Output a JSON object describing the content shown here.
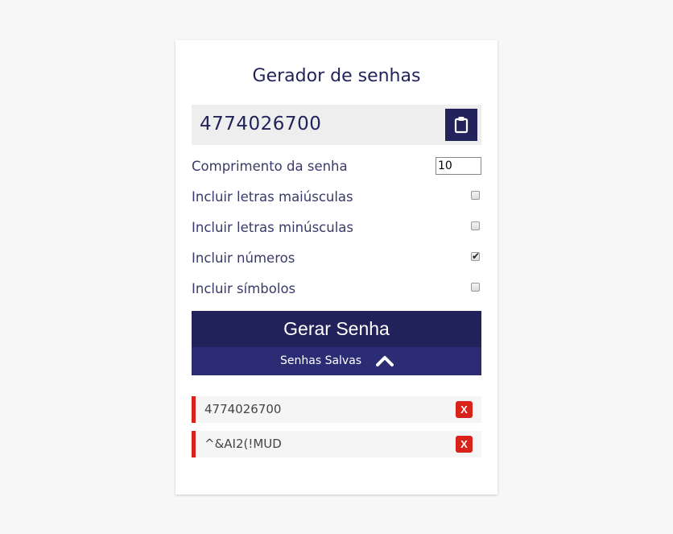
{
  "app": {
    "title": "Gerador de senhas"
  },
  "result": {
    "password": "4774026700",
    "copy_icon": "clipboard-icon"
  },
  "options": {
    "length_label": "Comprimento da senha",
    "length_value": "10",
    "uppercase_label": "Incluir letras maiúsculas",
    "uppercase_checked": false,
    "lowercase_label": "Incluir letras minúsculas",
    "lowercase_checked": false,
    "numbers_label": "Incluir números",
    "numbers_checked": true,
    "symbols_label": "Incluir símbolos",
    "symbols_checked": false
  },
  "actions": {
    "generate_label": "Gerar Senha",
    "saved_toggle_label": "Senhas Salvas",
    "saved_toggle_icon": "chevron-up-icon"
  },
  "saved_passwords": [
    {
      "value": "4774026700",
      "delete_label": "X"
    },
    {
      "value": "^&AI2(!MUD",
      "delete_label": "X"
    }
  ],
  "colors": {
    "primary": "#23235b",
    "secondary": "#2c2c74",
    "danger": "#d8231b",
    "background": "#f7f7f7"
  }
}
